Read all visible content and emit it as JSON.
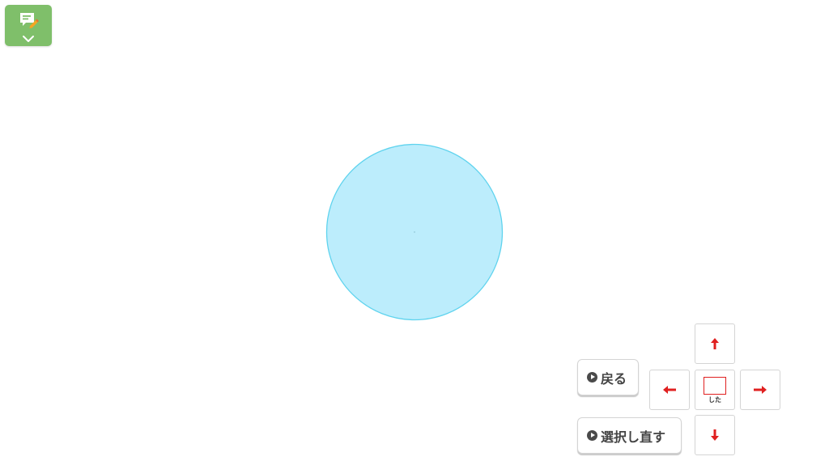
{
  "menu": {
    "icon": "memo-edit-icon",
    "chevron": "chevron-down-icon",
    "color": "#7fbf6a"
  },
  "shape": {
    "type": "circle",
    "fill": "#bcedfc",
    "stroke": "#5fd3ee"
  },
  "controls": {
    "back_label": "戻る",
    "reselect_label": "選択し直す",
    "play_icon": "play-circle-icon"
  },
  "dpad": {
    "arrow_color": "#e02020",
    "up_icon": "arrow-up-icon",
    "down_icon": "arrow-down-icon",
    "left_icon": "arrow-left-icon",
    "right_icon": "arrow-right-icon",
    "center_label": "した"
  }
}
